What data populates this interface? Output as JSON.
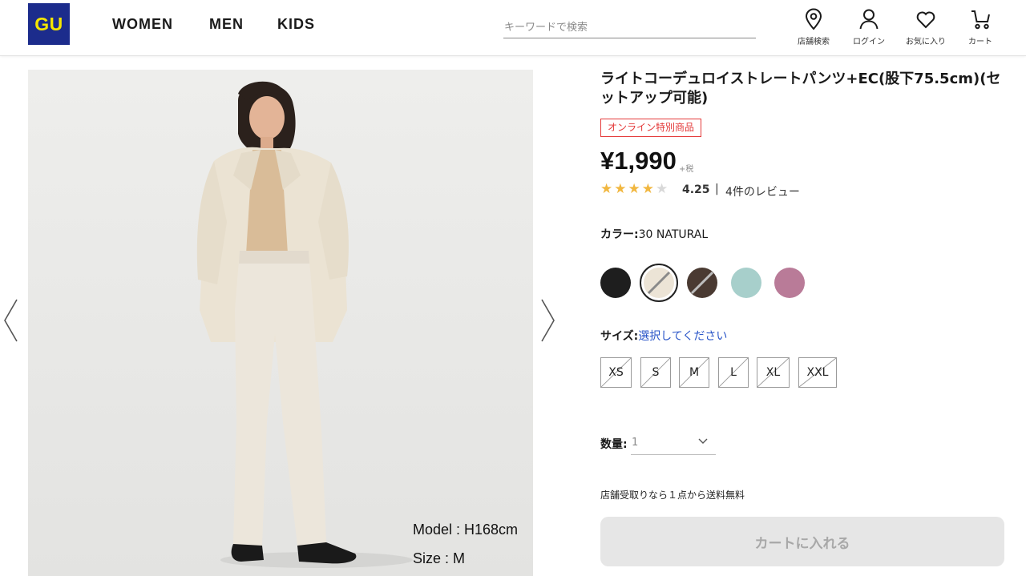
{
  "brand": {
    "logo_text": "GU",
    "logo_bg": "#1c2c8c",
    "logo_fg": "#f5e600"
  },
  "nav": {
    "women": "WOMEN",
    "men": "MEN",
    "kids": "KIDS"
  },
  "search": {
    "placeholder": "キーワードで検索",
    "value": ""
  },
  "header_icons": [
    {
      "icon": "map-pin-icon",
      "label": "店舗検索"
    },
    {
      "icon": "user-icon",
      "label": "ログイン"
    },
    {
      "icon": "heart-icon",
      "label": "お気に入り"
    },
    {
      "icon": "cart-icon",
      "label": "カート"
    }
  ],
  "gallery": {
    "model_height": "Model : H168cm",
    "model_size": "Size : M"
  },
  "product": {
    "title": "ライトコーデュロイストレートパンツ+EC(股下75.5cm)(セットアップ可能)",
    "badge": "オンライン特別商品",
    "badge_color": "#e43a3a",
    "price": "¥1,990",
    "tax_note": "+税",
    "rating": "4.25",
    "rating_stars": 4.25,
    "rating_max": 5,
    "rating_separator": "|",
    "review_text": "4件のレビュー"
  },
  "color": {
    "label": "カラー:",
    "selected": "30 NATURAL",
    "swatches": [
      {
        "hex": "#1e1e1e",
        "unavailable": false
      },
      {
        "hex": "#ece4d6",
        "unavailable": true,
        "selected": true
      },
      {
        "hex": "#4a3a32",
        "unavailable": true
      },
      {
        "hex": "#a7cfcb",
        "unavailable": false
      },
      {
        "hex": "#b97b98",
        "unavailable": false
      }
    ]
  },
  "size": {
    "label": "サイズ:",
    "prompt": "選択してください",
    "prompt_color": "#2a55c8",
    "options": [
      "XS",
      "S",
      "M",
      "L",
      "XL",
      "XXL"
    ]
  },
  "quantity": {
    "label": "数量:",
    "value": "1"
  },
  "store_note": "店舗受取りなら１点から送料無料",
  "cart_button": "カートに入れる"
}
